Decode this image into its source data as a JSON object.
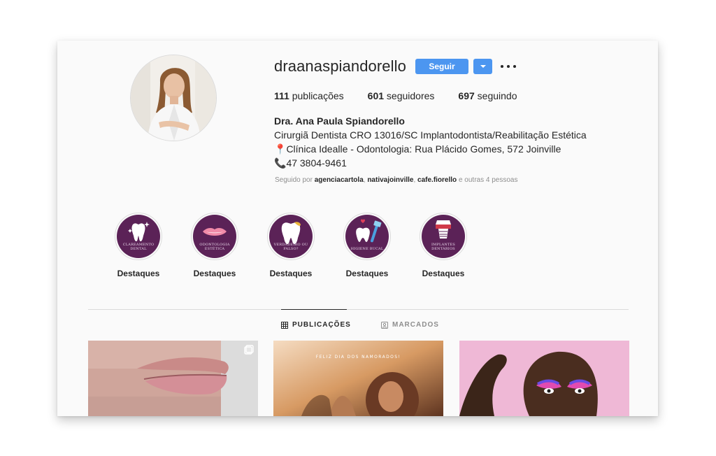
{
  "profile": {
    "username": "draanaspiandorello",
    "follow_label": "Seguir",
    "stats": {
      "posts_count": "111",
      "posts_label": "publicações",
      "followers_count": "601",
      "followers_label": "seguidores",
      "following_count": "697",
      "following_label": "seguindo"
    },
    "bio": {
      "name": "Dra. Ana Paula Spiandorello",
      "line1": "Cirurgiã Dentista CRO 13016/SC Implantodontista/Reabilitação Estética",
      "line2": "Clínica Idealle - Odontologia: Rua Plácido Gomes, 572 Joinville",
      "line2_icon": "📍",
      "line3": "47 3804-9461",
      "line3_icon": "📞"
    },
    "followed_by": {
      "prefix": "Seguido por",
      "user1": "agenciacartola",
      "user2": "nativajoinville",
      "user3": "cafe.fiorello",
      "suffix": "e outras 4 pessoas"
    }
  },
  "highlights": [
    {
      "label": "Destaques",
      "caption": "CLAREAMENTO DENTAL",
      "icon": "tooth-sparkle-icon"
    },
    {
      "label": "Destaques",
      "caption": "ODONTOLOGIA ESTÉTICA",
      "icon": "lips-icon"
    },
    {
      "label": "Destaques",
      "caption": "VERDADEIRO OU FALSO?",
      "icon": "tooth-crown-icon"
    },
    {
      "label": "Destaques",
      "caption": "HIGIENE BUCAL",
      "icon": "tooth-brush-icon"
    },
    {
      "label": "Destaques",
      "caption": "IMPLANTES DENTÁRIOS",
      "icon": "implant-icon"
    }
  ],
  "tabs": {
    "posts": "PUBLICAÇÕES",
    "tagged": "MARCADOS"
  },
  "posts": [
    {
      "name": "post-lips",
      "caption": ""
    },
    {
      "name": "post-valentines",
      "caption": "FELIZ DIA DOS NAMORADOS!"
    },
    {
      "name": "post-makeup",
      "caption": ""
    }
  ],
  "colors": {
    "accent": "#4c96f0",
    "highlight_bg": "#5b2257"
  }
}
